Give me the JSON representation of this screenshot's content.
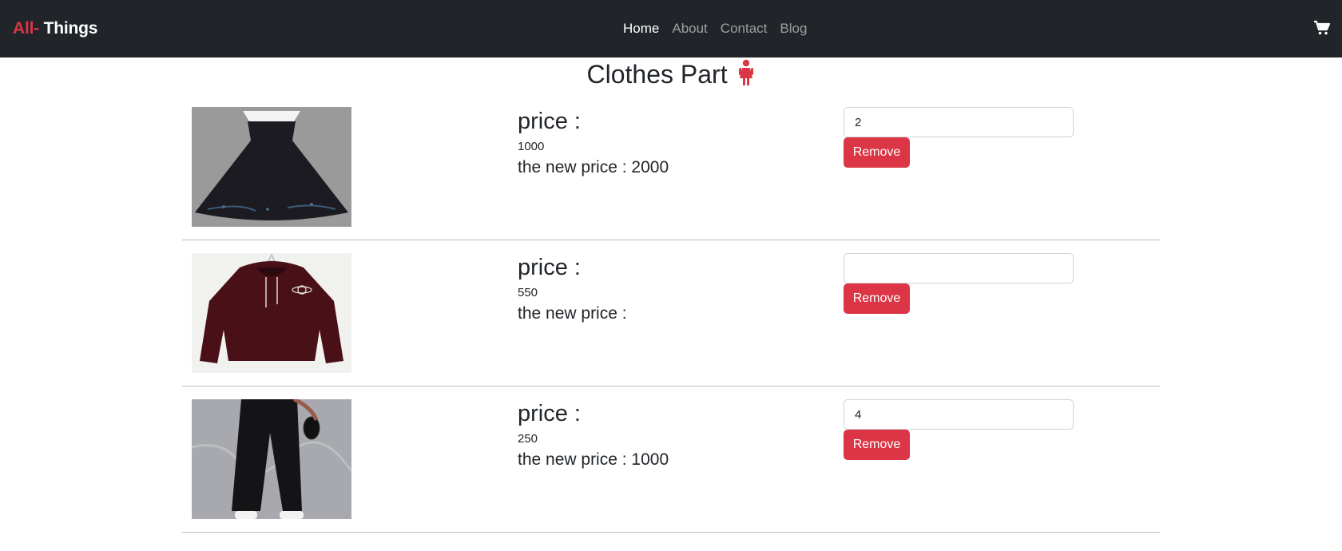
{
  "navbar": {
    "brand_accent": "All-",
    "brand_main": " Things",
    "links": [
      {
        "label": "Home",
        "active": true
      },
      {
        "label": "About",
        "active": false
      },
      {
        "label": "Contact",
        "active": false
      },
      {
        "label": "Blog",
        "active": false
      }
    ],
    "cart_icon": "cart-icon"
  },
  "page": {
    "title": "Clothes Part",
    "title_icon": "girl-icon"
  },
  "items": [
    {
      "image": "black-dress",
      "price_label": "price :",
      "price": "1000",
      "new_price_label": "the new price : 2000",
      "qty_value": "2",
      "remove_label": "Remove"
    },
    {
      "image": "maroon-hoodie",
      "price_label": "price :",
      "price": "550",
      "new_price_label": "the new price :",
      "qty_value": "",
      "remove_label": "Remove"
    },
    {
      "image": "black-pants",
      "price_label": "price :",
      "price": "250",
      "new_price_label": "the new price : 1000",
      "qty_value": "4",
      "remove_label": "Remove"
    }
  ],
  "colors": {
    "accent": "#dc3545",
    "navbar": "#212529"
  }
}
